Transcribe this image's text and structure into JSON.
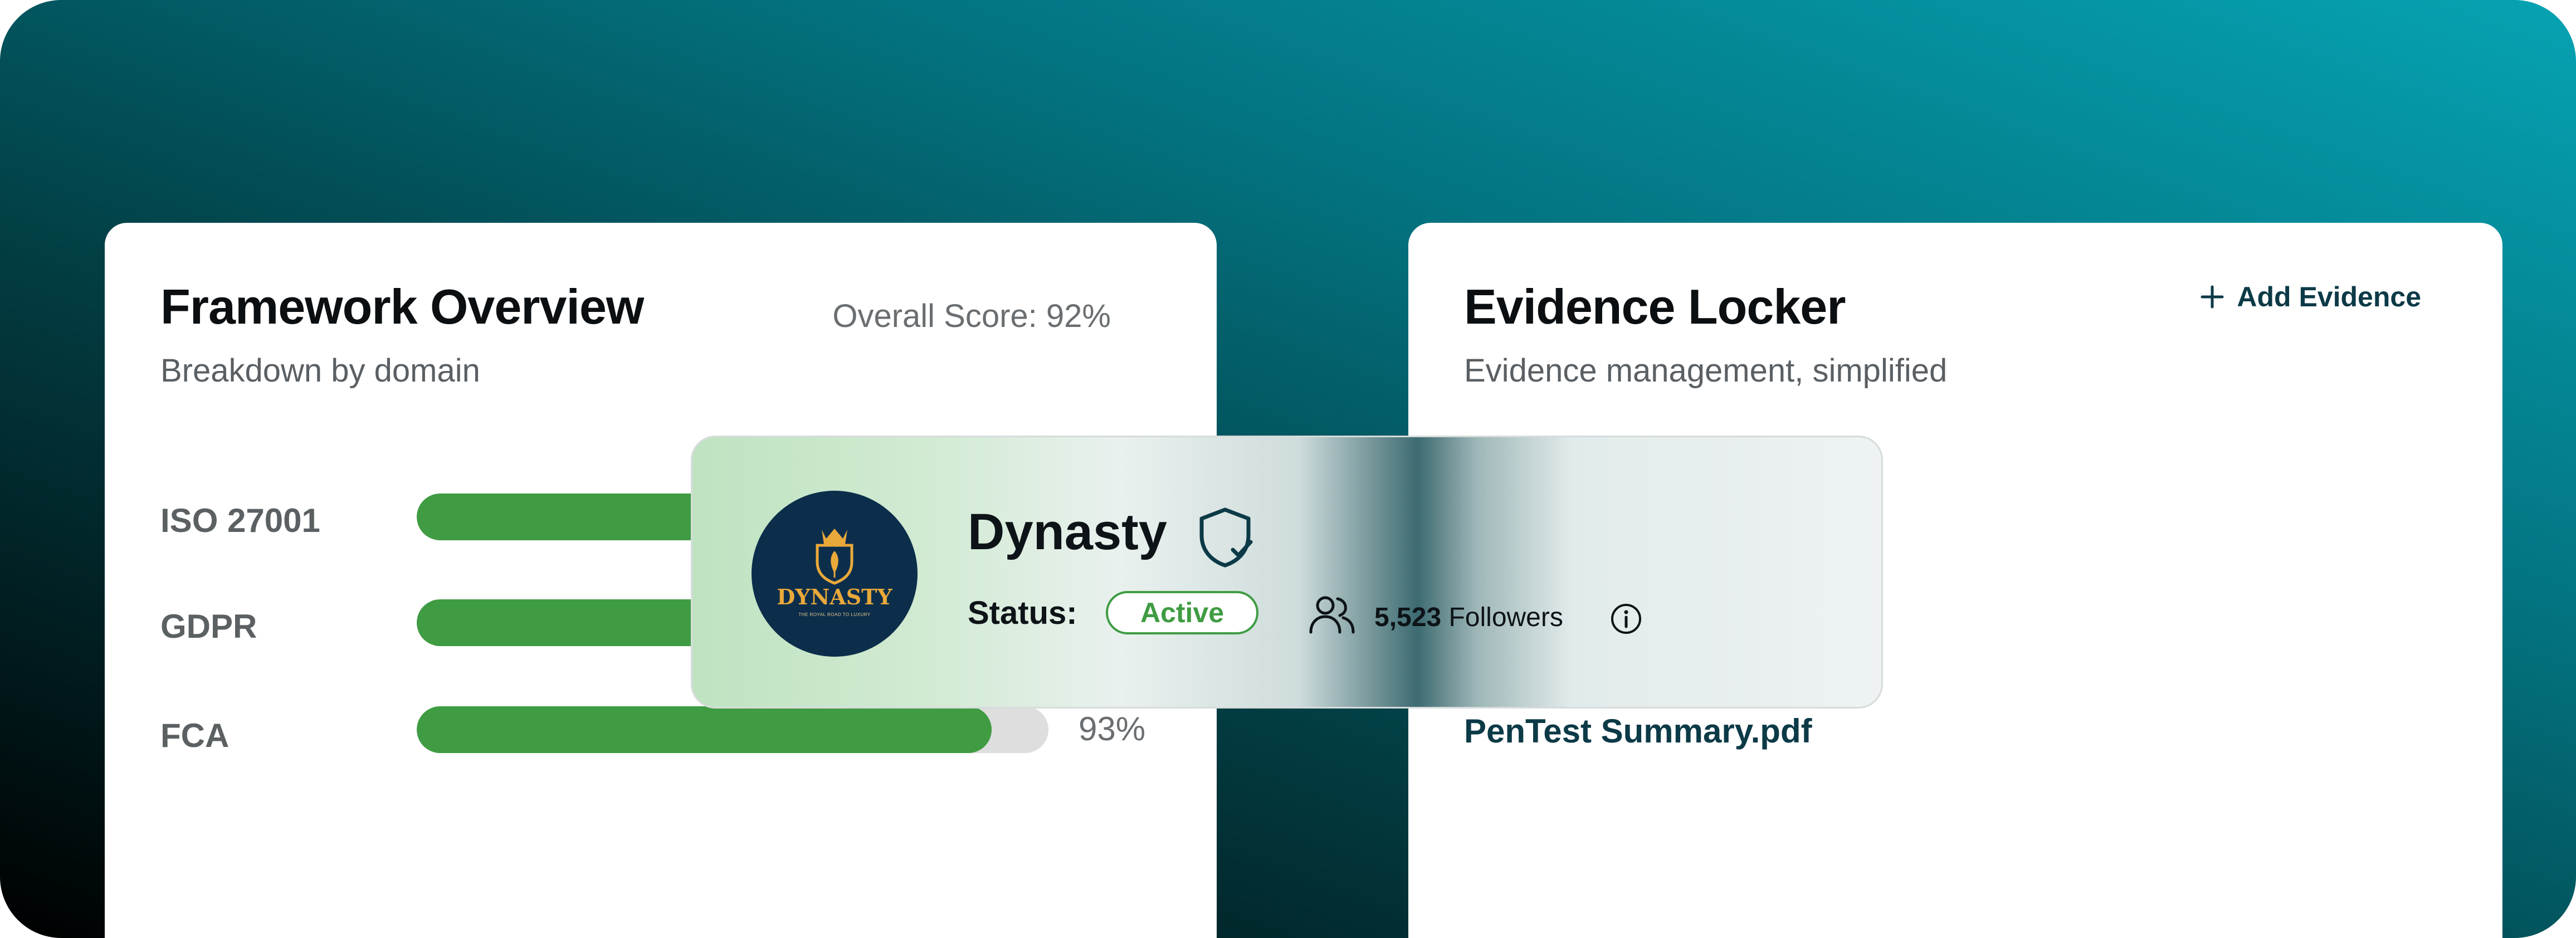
{
  "framework": {
    "title": "Framework Overview",
    "subtitle": "Breakdown by domain",
    "score": "Overall Score: 92%",
    "rows": [
      {
        "label": "ISO 27001",
        "progress": 0.84
      },
      {
        "label": "GDPR",
        "progress": 0.84
      },
      {
        "label": "FCA",
        "progress": 0.91,
        "percent": "93%"
      }
    ]
  },
  "evidence": {
    "title": "Evidence Locker",
    "subtitle": "Evidence management, simplified",
    "add_label": "Add Evidence",
    "file": "PenTest Summary.pdf"
  },
  "profile": {
    "name": "Dynasty",
    "logo_text": "DYNASTY",
    "logo_tagline": "THE ROYAL ROAD TO LUXURY",
    "status_label": "Status:",
    "status_value": "Active",
    "followers_count": "5,523",
    "followers_label": "Followers"
  },
  "colors": {
    "accent_green": "#3f9c43",
    "dark_teal": "#0c3a47",
    "gradient_start": "#06a3b3",
    "gradient_end": "#000000"
  },
  "icons": [
    "plus-icon",
    "shield-check-icon",
    "users-icon",
    "info-icon"
  ]
}
